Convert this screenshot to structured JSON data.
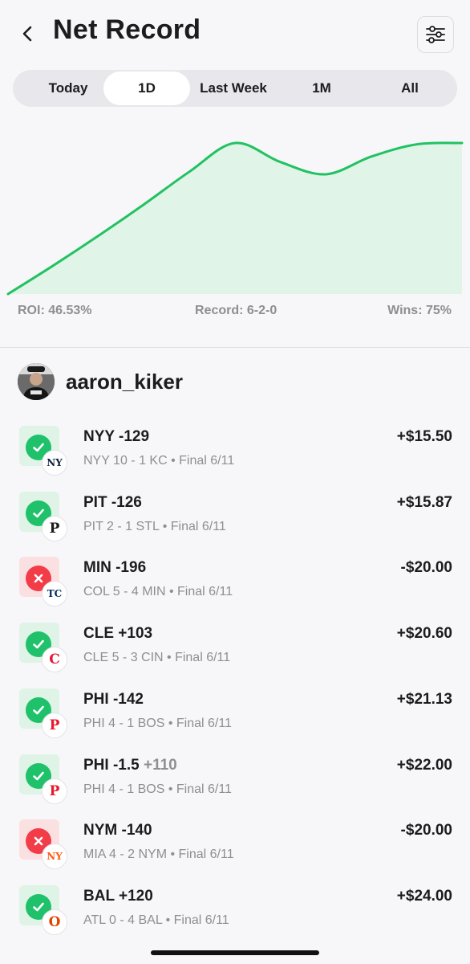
{
  "header": {
    "title": "Net Record"
  },
  "tabs": [
    {
      "label": "Today",
      "active": false
    },
    {
      "label": "1D",
      "active": true
    },
    {
      "label": "Last Week",
      "active": false
    },
    {
      "label": "1M",
      "active": false
    },
    {
      "label": "All",
      "active": false
    }
  ],
  "chart_data": {
    "type": "area",
    "title": "",
    "xlabel": "",
    "ylabel": "",
    "series": [
      {
        "values": [
          0,
          2.1,
          4.3,
          6.6,
          9.0,
          11.1,
          9.7,
          8.8,
          10.1,
          11.0,
          11.1
        ]
      }
    ],
    "line_color": "#22c262",
    "fill_color": "#e0f4e8",
    "grid": false
  },
  "stats": {
    "roi": "ROI: 46.53%",
    "record": "Record: 6-2-0",
    "wins": "Wins: 75%"
  },
  "user": {
    "username": "aaron_kiker"
  },
  "bets": [
    {
      "status": "win",
      "pick": "NYY -129",
      "pick_extra": "",
      "result": "NYY 10 - 1 KC • Final 6/11",
      "amount": "+$15.50",
      "team_logo": "NY",
      "logo_color": "#0c2340"
    },
    {
      "status": "win",
      "pick": "PIT -126",
      "pick_extra": "",
      "result": "PIT 2 - 1 STL • Final 6/11",
      "amount": "+$15.87",
      "team_logo": "P",
      "logo_color": "#1a1a1a"
    },
    {
      "status": "loss",
      "pick": "MIN -196",
      "pick_extra": "",
      "result": "COL 5 - 4 MIN • Final 6/11",
      "amount": "-$20.00",
      "team_logo": "TC",
      "logo_color": "#002b5c"
    },
    {
      "status": "win",
      "pick": "CLE +103",
      "pick_extra": "",
      "result": "CLE 5 - 3 CIN • Final 6/11",
      "amount": "+$20.60",
      "team_logo": "C",
      "logo_color": "#e31937"
    },
    {
      "status": "win",
      "pick": "PHI -142",
      "pick_extra": "",
      "result": "PHI 4 - 1 BOS • Final 6/11",
      "amount": "+$21.13",
      "team_logo": "P",
      "logo_color": "#e81828"
    },
    {
      "status": "win",
      "pick": "PHI -1.5",
      "pick_extra": " +110",
      "result": "PHI 4 - 1 BOS • Final 6/11",
      "amount": "+$22.00",
      "team_logo": "P",
      "logo_color": "#e81828"
    },
    {
      "status": "loss",
      "pick": "NYM -140",
      "pick_extra": "",
      "result": "MIA 4 - 2 NYM • Final 6/11",
      "amount": "-$20.00",
      "team_logo": "NY",
      "logo_color": "#ff5910"
    },
    {
      "status": "win",
      "pick": "BAL +120",
      "pick_extra": "",
      "result": "ATL 0 - 4 BAL • Final 6/11",
      "amount": "+$24.00",
      "team_logo": "O",
      "logo_color": "#df4601"
    }
  ]
}
